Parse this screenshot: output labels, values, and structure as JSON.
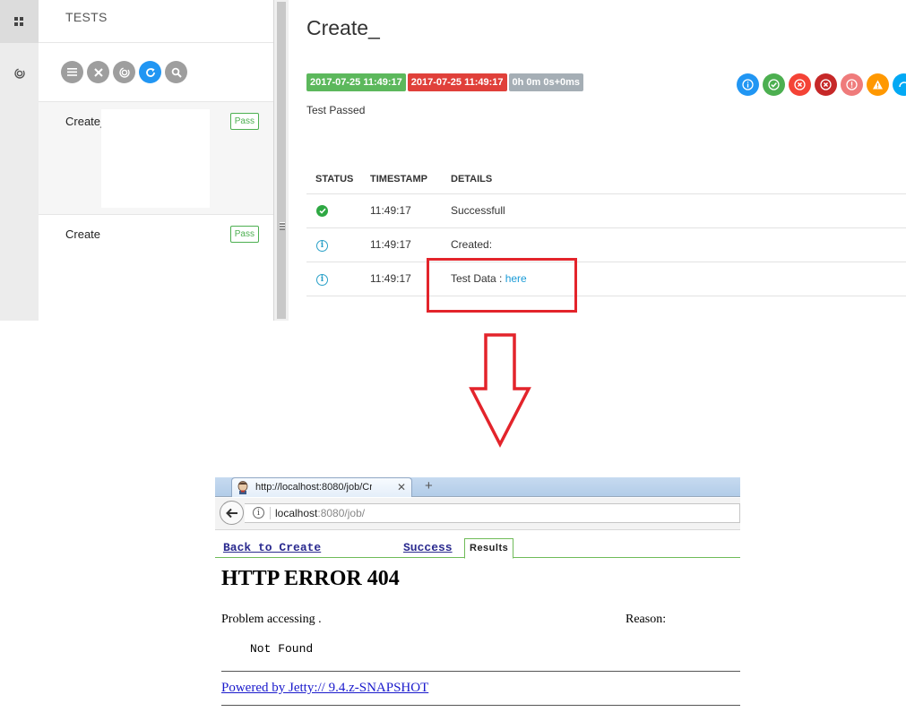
{
  "report": {
    "sidebar_title": "TESTS",
    "toolbar_icons": [
      "list-icon",
      "close-icon",
      "fingerprint-icon",
      "refresh-icon",
      "search-icon"
    ],
    "tests": [
      {
        "name": "Create_",
        "status": "Pass"
      },
      {
        "name": "Create",
        "status": "Pass"
      }
    ],
    "detail": {
      "title": "Create_",
      "start_time": "2017-07-25 11:49:17",
      "end_time": "2017-07-25 11:49:17",
      "duration": "0h 0m 0s+0ms",
      "status_text": "Test Passed",
      "filter_icons": [
        {
          "name": "info-icon",
          "color": "#2196f3"
        },
        {
          "name": "pass-icon",
          "color": "#4caf50"
        },
        {
          "name": "fail-icon",
          "color": "#f44336"
        },
        {
          "name": "fatal-icon",
          "color": "#c62828"
        },
        {
          "name": "error-icon",
          "color": "#ef7b7b"
        },
        {
          "name": "warning-icon",
          "color": "#ff9800"
        },
        {
          "name": "skip-icon",
          "color": "#03a9f4"
        }
      ],
      "table": {
        "headers": [
          "STATUS",
          "TIMESTAMP",
          "DETAILS"
        ],
        "rows": [
          {
            "status": "pass",
            "timestamp": "11:49:17",
            "details": "Successfull"
          },
          {
            "status": "info",
            "timestamp": "11:49:17",
            "details": "Created:"
          },
          {
            "status": "info",
            "timestamp": "11:49:17",
            "details_prefix": "Test Data : ",
            "link": "here"
          }
        ]
      }
    }
  },
  "browser": {
    "tab_title": "http://localhost:8080/job/Cre",
    "url_host": "localhost",
    "url_rest": ":8080/job/",
    "jenkins": {
      "back_link": "Back to Create",
      "success_link": "Success",
      "results_tab": "Results"
    },
    "error_title": "HTTP ERROR 404",
    "problem_text": "Problem accessing .",
    "reason_label": "Reason:",
    "reason_value": "Not Found",
    "powered_by": "Powered by Jetty:// 9.4.z-SNAPSHOT"
  },
  "colors": {
    "highlight": "#e3242b",
    "pass": "#5cb85c",
    "fail": "#e0403a"
  }
}
